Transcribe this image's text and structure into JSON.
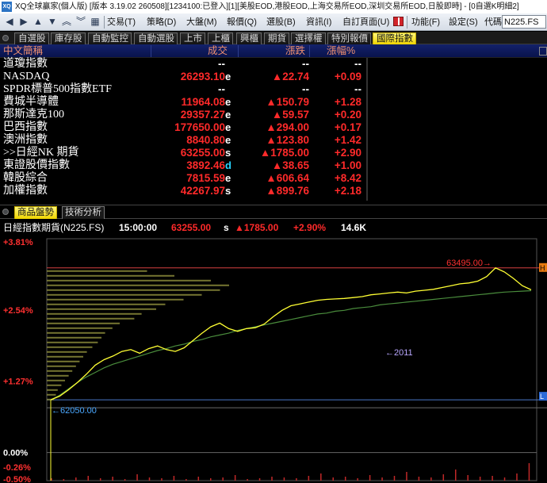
{
  "window": {
    "app_icon": "XQ",
    "title": "XQ全球贏家(個人版) [版本 3.19.02 260508][1234100:已登入][1][美股EOD,港股EOD,上海交易所EOD,深圳交易所EOD,日股即時] - [0自選K明細2]"
  },
  "toolbar": {
    "nav_icons": [
      "back-arrow-icon",
      "forward-arrow-icon",
      "up-arrow-icon",
      "down-arrow-icon",
      "double-chevron-icon",
      "double-chevron-down-icon",
      "grid-icon"
    ],
    "menu": [
      "交易(T)",
      "策略(D)",
      "大盤(M)",
      "報價(Q)",
      "選股(B)",
      "資訊(I)",
      "自訂頁面(U)",
      "功能(F)",
      "設定(S)",
      "代碼"
    ],
    "symbol_value": "N225.FS"
  },
  "quote_panel": {
    "tabs": [
      "自選股",
      "庫存股",
      "自動監控",
      "自動選股",
      "上市",
      "上櫃",
      "興櫃",
      "期貨",
      "選擇權",
      "特別報價",
      "國際指數"
    ],
    "active_tab": "國際指數",
    "columns": [
      "中文簡稱",
      "成交",
      "漲跌",
      "漲幅%"
    ],
    "rows": [
      {
        "name": "道瓊指數",
        "price": "--",
        "suffix": "",
        "change": "--",
        "pct": "--"
      },
      {
        "name": "NASDAQ",
        "price": "26293.10",
        "suffix": "e",
        "change": "▲22.74",
        "pct": "+0.09"
      },
      {
        "name": "SPDR標普500指數ETF",
        "price": "--",
        "suffix": "",
        "change": "--",
        "pct": "--"
      },
      {
        "name": "費城半導體",
        "price": "11964.08",
        "suffix": "e",
        "change": "▲150.79",
        "pct": "+1.28"
      },
      {
        "name": "那斯達克100",
        "price": "29357.27",
        "suffix": "e",
        "change": "▲59.57",
        "pct": "+0.20"
      },
      {
        "name": "巴西指數",
        "price": "177650.00",
        "suffix": "e",
        "change": "▲294.00",
        "pct": "+0.17"
      },
      {
        "name": "澳洲指數",
        "price": "8840.80",
        "suffix": "e",
        "change": "▲123.80",
        "pct": "+1.42"
      },
      {
        "name": ">>日經NK 期貨",
        "price": "63255.00",
        "suffix": "s",
        "change": "▲1785.00",
        "pct": "+2.90"
      },
      {
        "name": "東證股價指數",
        "price": "3892.46",
        "suffix": "d",
        "change": "▲38.65",
        "pct": "+1.00"
      },
      {
        "name": "韓股綜合",
        "price": "7815.59",
        "suffix": "e",
        "change": "▲606.64",
        "pct": "+8.42"
      },
      {
        "name": "加權指數",
        "price": "42267.97",
        "suffix": "s",
        "change": "▲899.76",
        "pct": "+2.18"
      }
    ]
  },
  "chart_panel": {
    "tabs": [
      "商品盤勢",
      "技術分析"
    ],
    "active_tab": "商品盤勢",
    "instrument": "日經指數期貨(N225.FS)",
    "time": "15:00:00",
    "last": "63255.00",
    "last_flag": "s",
    "change": "▲1785.00",
    "change_pct": "+2.90%",
    "volume": "14.6K",
    "y_axis_labels": [
      "+3.81%",
      "+2.54%",
      "+1.27%",
      "0.00%",
      "-0.26%",
      "-0.50%"
    ],
    "annotations": {
      "high": "63495.00",
      "low": "62050.00",
      "mid": "2011"
    },
    "right_markers": [
      "H",
      "L"
    ],
    "colors": {
      "price_line": "#ffff33",
      "avg_line": "#4a8c3c",
      "ref_line_red": "#d64040",
      "ref_line_blue": "#4a78c8",
      "volume_profile": "#8a8a3a",
      "volume_bars": "#c02828"
    }
  },
  "chart_data": {
    "type": "line",
    "title": "",
    "xlabel": "",
    "ylabel": "",
    "ylim_pct": [
      -0.5,
      3.81
    ],
    "price": [
      62050,
      62090,
      62160,
      62240,
      62330,
      62430,
      62490,
      62530,
      62580,
      62600,
      62560,
      62610,
      62640,
      62600,
      62580,
      62620,
      62700,
      62780,
      62850,
      62890,
      62830,
      62800,
      62830,
      62840,
      62880,
      62960,
      63030,
      63080,
      63100,
      63120,
      63140,
      63150,
      63155,
      63160,
      63170,
      63180,
      63200,
      63210,
      63220,
      63230,
      63220,
      63240,
      63250,
      63260,
      63280,
      63300,
      63320,
      63330,
      63350,
      63400,
      63495,
      63450,
      63380,
      63300,
      63255
    ],
    "avg_price": [
      62050,
      62100,
      62170,
      62240,
      62300,
      62350,
      62400,
      62440,
      62470,
      62500,
      62530,
      62560,
      62590,
      62610,
      62640,
      62660,
      62690,
      62710,
      62740,
      62760,
      62780,
      62810,
      62830,
      62850,
      62870,
      62890,
      62910,
      62930,
      62950,
      62970,
      62990,
      63000,
      63020,
      63030,
      63050,
      63060,
      63070,
      63090,
      63100,
      63110,
      63120,
      63130,
      63140,
      63150,
      63160,
      63170,
      63180,
      63190,
      63200,
      63210,
      63220,
      63230,
      63235,
      63240,
      63245
    ],
    "high": 63495.0,
    "low": 62050.0,
    "last": 63255.0,
    "marker_time": "2011"
  }
}
